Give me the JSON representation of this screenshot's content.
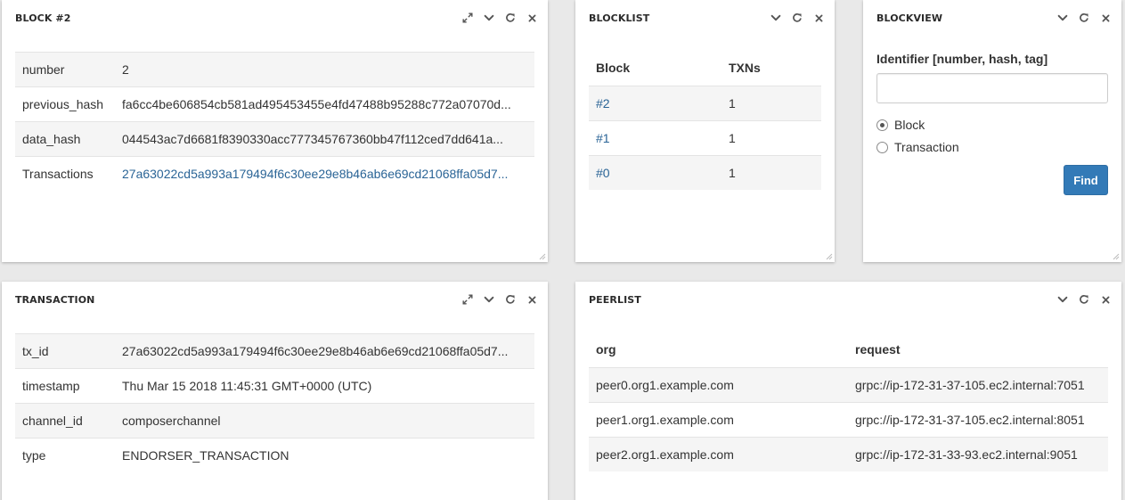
{
  "block_panel": {
    "title": "BLOCK #2",
    "rows": [
      {
        "key": "number",
        "value": "2"
      },
      {
        "key": "previous_hash",
        "value": "fa6cc4be606854cb581ad495453455e4fd47488b95288c772a07070d..."
      },
      {
        "key": "data_hash",
        "value": "044543ac7d6681f8390330acc777345767360bb47f112ced7dd641a..."
      },
      {
        "key": "Transactions",
        "value": "27a63022cd5a993a179494f6c30ee29e8b46ab6e69cd21068ffa05d7..."
      }
    ]
  },
  "blocklist_panel": {
    "title": "BLOCKLIST",
    "headers": [
      "Block",
      "TXNs"
    ],
    "rows": [
      {
        "block": "#2",
        "txns": "1"
      },
      {
        "block": "#1",
        "txns": "1"
      },
      {
        "block": "#0",
        "txns": "1"
      }
    ]
  },
  "blockview_panel": {
    "title": "BLOCKVIEW",
    "identifier_label": "Identifier [number, hash, tag]",
    "identifier_value": "",
    "radio_options": [
      {
        "label": "Block",
        "checked": true
      },
      {
        "label": "Transaction",
        "checked": false
      }
    ],
    "find_label": "Find"
  },
  "transaction_panel": {
    "title": "TRANSACTION",
    "rows": [
      {
        "key": "tx_id",
        "value": "27a63022cd5a993a179494f6c30ee29e8b46ab6e69cd21068ffa05d7..."
      },
      {
        "key": "timestamp",
        "value": "Thu Mar 15 2018 11:45:31 GMT+0000 (UTC)"
      },
      {
        "key": "channel_id",
        "value": "composerchannel"
      },
      {
        "key": "type",
        "value": "ENDORSER_TRANSACTION"
      }
    ]
  },
  "peerlist_panel": {
    "title": "PEERLIST",
    "headers": [
      "org",
      "request"
    ],
    "rows": [
      {
        "org": "peer0.org1.example.com",
        "request": "grpc://ip-172-31-37-105.ec2.internal:7051"
      },
      {
        "org": "peer1.org1.example.com",
        "request": "grpc://ip-172-31-37-105.ec2.internal:8051"
      },
      {
        "org": "peer2.org1.example.com",
        "request": "grpc://ip-172-31-33-93.ec2.internal:9051"
      }
    ]
  },
  "icons": {
    "expand": "expand-icon",
    "collapse": "chevron-down-icon",
    "refresh": "refresh-icon",
    "close": "close-icon"
  },
  "colors": {
    "link": "#2a6496",
    "primary_button": "#337ab7",
    "background": "#e9e9e9",
    "row_stripe": "#f5f5f5"
  }
}
